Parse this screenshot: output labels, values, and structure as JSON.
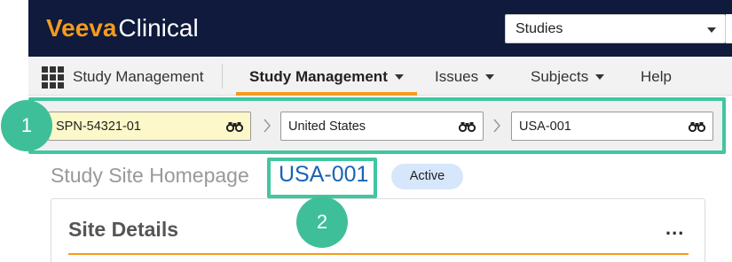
{
  "header": {
    "logo_brand": "Veeva",
    "logo_product": "Clinical",
    "studies_select": {
      "value": "Studies"
    }
  },
  "nav": {
    "app_label": "Study Management",
    "tabs": [
      {
        "label": "Study Management",
        "active": true,
        "has_menu": true
      },
      {
        "label": "Issues",
        "active": false,
        "has_menu": true
      },
      {
        "label": "Subjects",
        "active": false,
        "has_menu": true
      },
      {
        "label": "Help",
        "active": false,
        "has_menu": false
      }
    ]
  },
  "breadcrumbs": [
    {
      "value": "SPN-54321-01",
      "icon": "binoculars-icon"
    },
    {
      "value": "United States",
      "icon": "binoculars-icon"
    },
    {
      "value": "USA-001",
      "icon": "binoculars-icon"
    }
  ],
  "page": {
    "title": "Study Site Homepage",
    "site_id": "USA-001",
    "status": "Active"
  },
  "card": {
    "title": "Site Details",
    "more_label": "..."
  },
  "callouts": {
    "one": "1",
    "two": "2"
  },
  "colors": {
    "header_bg": "#0f1a3c",
    "accent_orange": "#f39b1e",
    "callout_green": "#40c6a0",
    "link_blue": "#1a63b5",
    "input_yellow": "#fdf8c9",
    "status_pill": "#d6e6fb"
  }
}
